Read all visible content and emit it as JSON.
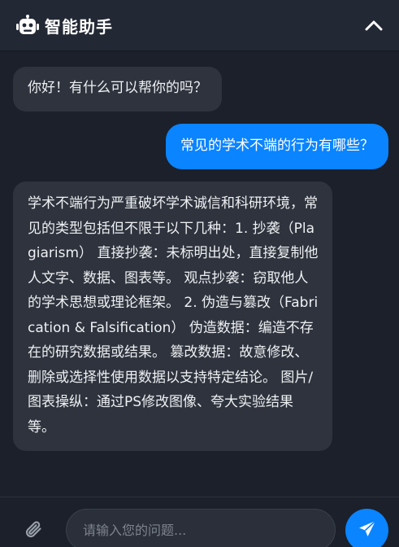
{
  "header": {
    "icon": "robot-icon",
    "title": "智能助手",
    "collapse_icon": "chevron-up-icon"
  },
  "messages": [
    {
      "role": "assistant",
      "text": "你好！有什么可以帮你的吗？"
    },
    {
      "role": "user",
      "text": "常见的学术不端的行为有哪些？"
    },
    {
      "role": "assistant",
      "text": "学术不端行为严重破坏学术诚信和科研环境，常见的类型包括但不限于以下几种：1. 抄袭（Plagiarism） 直接抄袭：未标明出处，直接复制他人文字、数据、图表等。 观点抄袭：窃取他人的学术思想或理论框架。 2. 伪造与篡改（Fabrication & Falsification） 伪造数据：编造不存在的研究数据或结果。 篡改数据：故意修改、删除或选择性使用数据以支持特定结论。 图片/图表操纵：通过PS修改图像、夸大实验结果等。"
    }
  ],
  "composer": {
    "attach_icon": "paperclip-icon",
    "placeholder": "请输入您的问题...",
    "value": "",
    "send_icon": "send-icon"
  },
  "colors": {
    "accent": "#0a84ff",
    "bot_bubble": "#2e333d",
    "background": "#1b202a",
    "header": "#222834"
  }
}
